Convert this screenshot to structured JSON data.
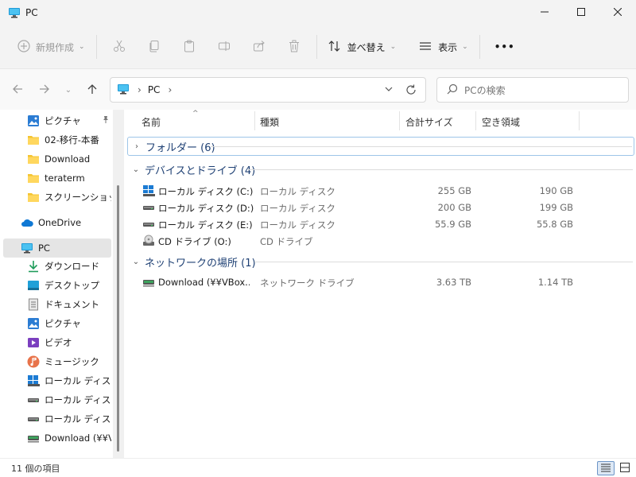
{
  "window": {
    "title": "PC"
  },
  "toolbar": {
    "new_label": "新規作成",
    "sort_label": "並べ替え",
    "view_label": "表示",
    "more_label": "•••"
  },
  "address": {
    "segment": "PC"
  },
  "search": {
    "placeholder": "PCの検索"
  },
  "sidebar": {
    "items": [
      {
        "label": "ピクチャ",
        "icon": "pictures-icon"
      },
      {
        "label": "02-移行-本番",
        "icon": "folder-icon"
      },
      {
        "label": "Download",
        "icon": "folder-icon"
      },
      {
        "label": "teraterm",
        "icon": "folder-icon"
      },
      {
        "label": "スクリーンショット",
        "icon": "folder-icon"
      },
      {
        "label": "OneDrive",
        "icon": "cloud-icon"
      },
      {
        "label": "PC",
        "icon": "computer-icon"
      },
      {
        "label": "ダウンロード",
        "icon": "download-icon"
      },
      {
        "label": "デスクトップ",
        "icon": "desktop-icon"
      },
      {
        "label": "ドキュメント",
        "icon": "document-icon"
      },
      {
        "label": "ピクチャ",
        "icon": "pictures-icon"
      },
      {
        "label": "ビデオ",
        "icon": "video-icon"
      },
      {
        "label": "ミュージック",
        "icon": "music-icon"
      },
      {
        "label": "ローカル ディスク (C",
        "icon": "system-drive-icon"
      },
      {
        "label": "ローカル ディスク (D",
        "icon": "drive-icon"
      },
      {
        "label": "ローカル ディスク (E",
        "icon": "drive-icon"
      },
      {
        "label": "Download (¥¥VB",
        "icon": "network-drive-icon"
      }
    ]
  },
  "columns": {
    "name": "名前",
    "type": "種類",
    "total": "合計サイズ",
    "free": "空き領域"
  },
  "groups": {
    "folders": "フォルダー (6)",
    "devices": "デバイスとドライブ (4)",
    "network": "ネットワークの場所 (1)"
  },
  "drives": [
    {
      "name": "ローカル ディスク (C:)",
      "type": "ローカル ディスク",
      "total": "255 GB",
      "free": "190 GB",
      "icon": "system-drive-icon"
    },
    {
      "name": "ローカル ディスク (D:)",
      "type": "ローカル ディスク",
      "total": "200 GB",
      "free": "199 GB",
      "icon": "drive-icon"
    },
    {
      "name": "ローカル ディスク (E:)",
      "type": "ローカル ディスク",
      "total": "55.9 GB",
      "free": "55.8 GB",
      "icon": "drive-icon"
    },
    {
      "name": "CD ドライブ (O:)",
      "type": "CD ドライブ",
      "total": "",
      "free": "",
      "icon": "cd-drive-icon"
    }
  ],
  "network_items": [
    {
      "name": "Download (¥¥VBox...",
      "type": "ネットワーク ドライブ",
      "total": "3.63 TB",
      "free": "1.14 TB",
      "icon": "network-drive-icon"
    }
  ],
  "status": {
    "count": "11 個の項目"
  }
}
